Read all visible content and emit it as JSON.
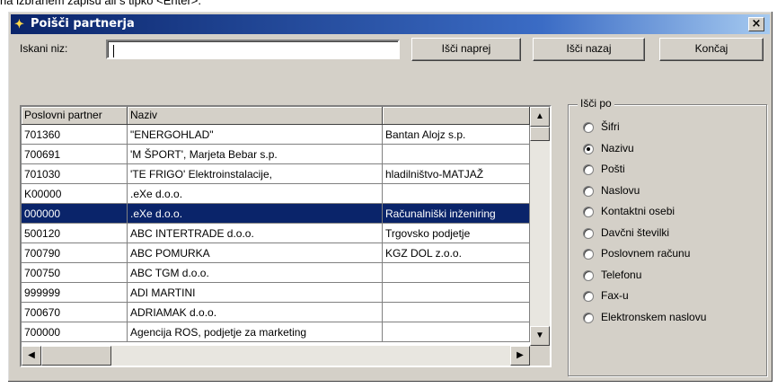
{
  "top_text": "na izbranem zapisu ali s tipko <Enter>.",
  "window": {
    "title": "Poišči partnerja",
    "close_label": "×"
  },
  "search": {
    "label": "Iskani niz:",
    "value": ""
  },
  "buttons": {
    "next": "Išči naprej",
    "prev": "Išči nazaj",
    "end": "Končaj"
  },
  "table": {
    "columns": [
      "Poslovni partner",
      "Naziv",
      ""
    ],
    "rows": [
      [
        "701360",
        "\"ENERGOHLAD\"",
        "Bantan Alojz s.p."
      ],
      [
        "700691",
        "'M ŠPORT', Marjeta Bebar s.p.",
        ""
      ],
      [
        "701030",
        "'TE FRIGO' Elektroinstalacije,",
        "hladilništvo-MATJAŽ"
      ],
      [
        "K00000",
        ".eXe d.o.o.",
        ""
      ],
      [
        "000000",
        ".eXe d.o.o.",
        "Računalniški inženiring"
      ],
      [
        "500120",
        "ABC INTERTRADE d.o.o.",
        "Trgovsko podjetje"
      ],
      [
        "700790",
        "ABC POMURKA",
        "KGZ DOL z.o.o."
      ],
      [
        "700750",
        "ABC TGM d.o.o.",
        ""
      ],
      [
        "999999",
        "ADI MARTINI",
        ""
      ],
      [
        "700670",
        "ADRIAMAK d.o.o.",
        ""
      ],
      [
        "700000",
        "Agencija ROS, podjetje za marketing",
        ""
      ]
    ],
    "selected_row": 4
  },
  "search_by": {
    "title": "Išči po",
    "options": [
      {
        "label": "Šifri",
        "checked": false
      },
      {
        "label": "Nazivu",
        "checked": true
      },
      {
        "label": "Pošti",
        "checked": false
      },
      {
        "label": "Naslovu",
        "checked": false
      },
      {
        "label": "Kontaktni osebi",
        "checked": false
      },
      {
        "label": "Davčni številki",
        "checked": false
      },
      {
        "label": "Poslovnem računu",
        "checked": false
      },
      {
        "label": "Telefonu",
        "checked": false
      },
      {
        "label": "Fax-u",
        "checked": false
      },
      {
        "label": "Elektronskem naslovu",
        "checked": false
      }
    ]
  },
  "icons": {
    "title": "app-icon",
    "close": "close-icon",
    "scroll_up": "arrow-up-icon",
    "scroll_down": "arrow-down-icon",
    "scroll_left": "arrow-left-icon",
    "scroll_right": "arrow-right-icon"
  },
  "colors": {
    "titlebar": "#0a246a",
    "selection": "#0a246a",
    "face": "#d4d0c8"
  }
}
